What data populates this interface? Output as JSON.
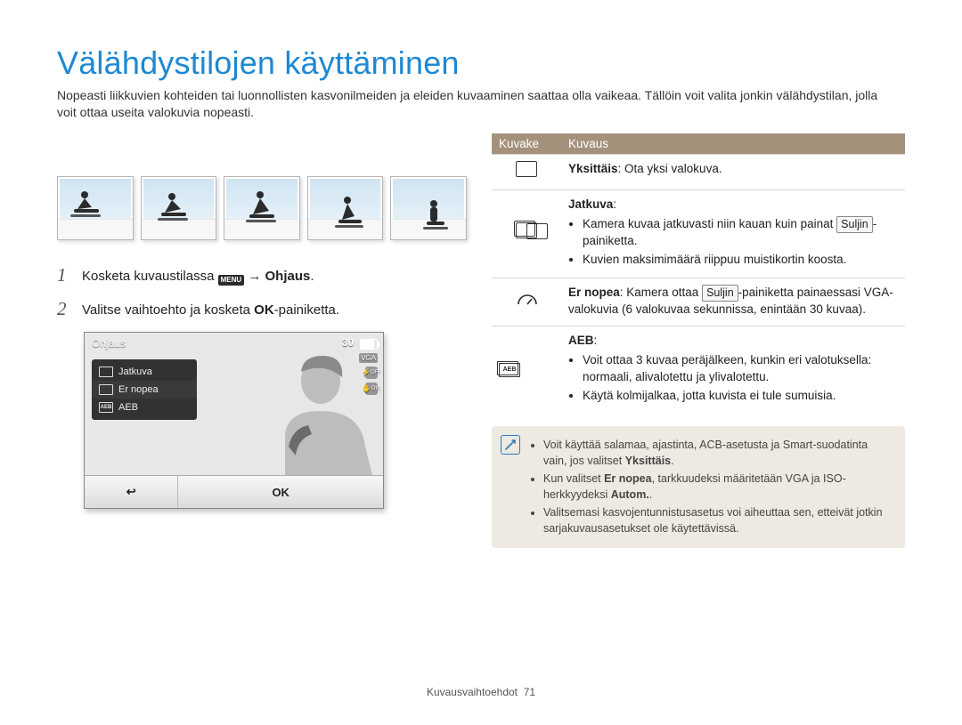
{
  "title": "Välähdystilojen käyttäminen",
  "intro": "Nopeasti liikkuvien kohteiden tai luonnollisten kasvonilmeiden ja eleiden kuvaaminen saattaa olla vaikeaa. Tällöin voit valita jonkin välähdystilan, jolla voit ottaa useita valokuvia nopeasti.",
  "steps": {
    "s1": {
      "num": "1",
      "pre": "Kosketa kuvaustilassa ",
      "menu": "MENU",
      "arrow": " → ",
      "suffix": "Ohjaus",
      "period": "."
    },
    "s2": {
      "num": "2",
      "pre": "Valitse vaihtoehto ja kosketa ",
      "ok": "OK",
      "suffix": "-painiketta."
    }
  },
  "camera": {
    "title": "Ohjaus",
    "count": "30",
    "vga": "VGA",
    "flash_off": "OFF",
    "ois": "OIS",
    "menu": {
      "item1": "Jatkuva",
      "item2": "Er nopea",
      "item3": "AEB"
    },
    "back": "↩",
    "ok": "OK"
  },
  "table": {
    "head1": "Kuvake",
    "head2": "Kuvaus",
    "row1": {
      "b": "Yksittäis",
      "rest": ": Ota yksi valokuva."
    },
    "row2": {
      "b": "Jatkuva",
      "colon": ":",
      "li1a": "Kamera kuvaa jatkuvasti niin kauan kuin painat ",
      "li1key": "Suljin",
      "li1b": "-painiketta.",
      "li2": "Kuvien maksimimäärä riippuu muistikortin koosta."
    },
    "row3": {
      "b": "Er nopea",
      "rest1": ": Kamera ottaa ",
      "key": "Suljin",
      "rest2": "-painiketta painaessasi VGA-valokuvia (6 valokuvaa sekunnissa, enintään 30 kuvaa)."
    },
    "row4": {
      "b": "AEB",
      "colon": ":",
      "li1": "Voit ottaa 3 kuvaa peräjälkeen, kunkin eri valotuksella: normaali, alivalotettu ja ylivalotettu.",
      "li2": "Käytä kolmijalkaa, jotta kuvista ei tule sumuisia."
    }
  },
  "note": {
    "li1a": "Voit käyttää salamaa, ajastinta, ACB-asetusta ja Smart-suodatinta vain, jos valitset ",
    "li1b": "Yksittäis",
    "li1c": ".",
    "li2a": "Kun valitset ",
    "li2b": "Er nopea",
    "li2c": ", tarkkuudeksi määritetään VGA ja ISO-herkkyydeksi ",
    "li2d": "Autom.",
    "li2e": ".",
    "li3": "Valitsemasi kasvojentunnistusasetus voi aiheuttaa sen, etteivät jotkin sarjakuvausasetukset ole käytettävissä."
  },
  "footer": {
    "label": "Kuvausvaihtoehdot",
    "page": "71"
  }
}
